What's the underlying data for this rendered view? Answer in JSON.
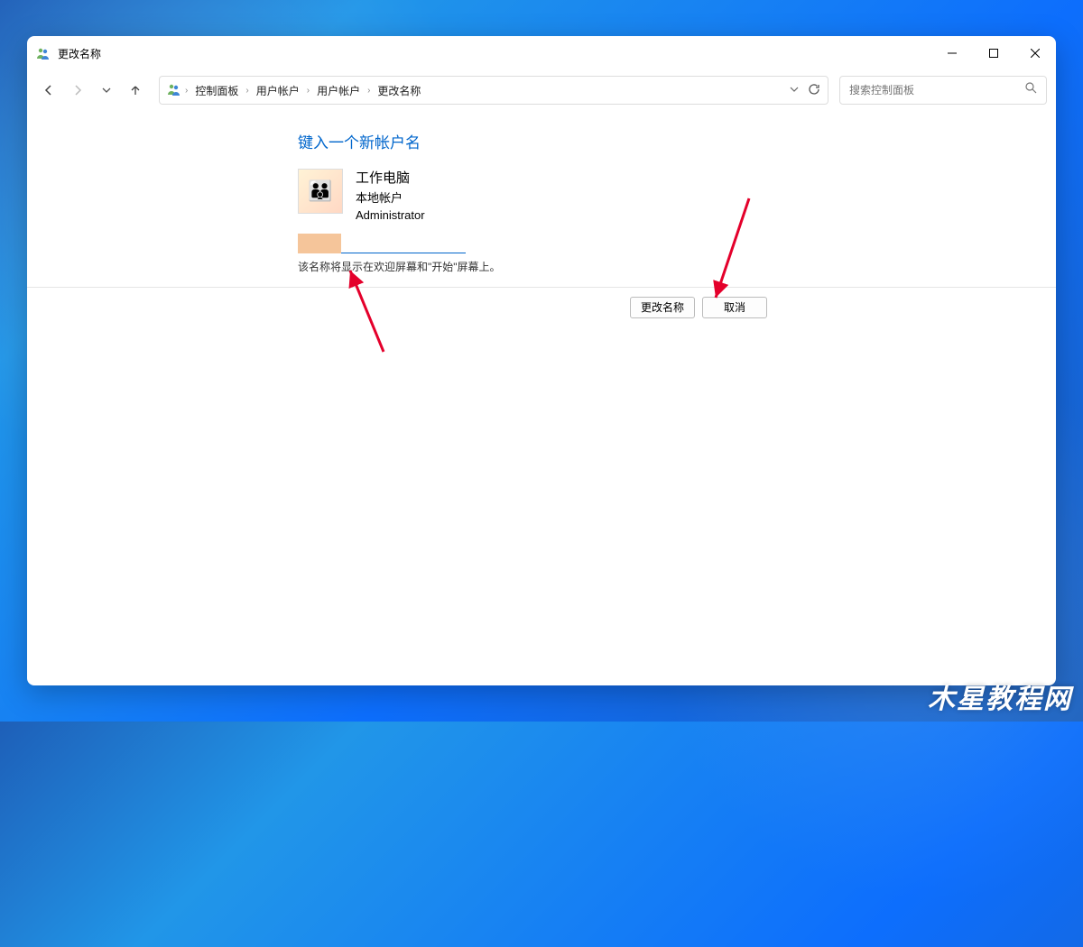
{
  "window": {
    "title": "更改名称"
  },
  "nav": {
    "breadcrumbs": [
      "控制面板",
      "用户帐户",
      "用户帐户",
      "更改名称"
    ],
    "search_placeholder": "搜索控制面板"
  },
  "page": {
    "heading": "键入一个新帐户名",
    "user": {
      "name": "工作电脑",
      "type": "本地帐户",
      "role": "Administrator"
    },
    "hint": "该名称将显示在欢迎屏幕和\"开始\"屏幕上。"
  },
  "buttons": {
    "confirm": "更改名称",
    "cancel": "取消"
  },
  "watermark": "木星教程网"
}
